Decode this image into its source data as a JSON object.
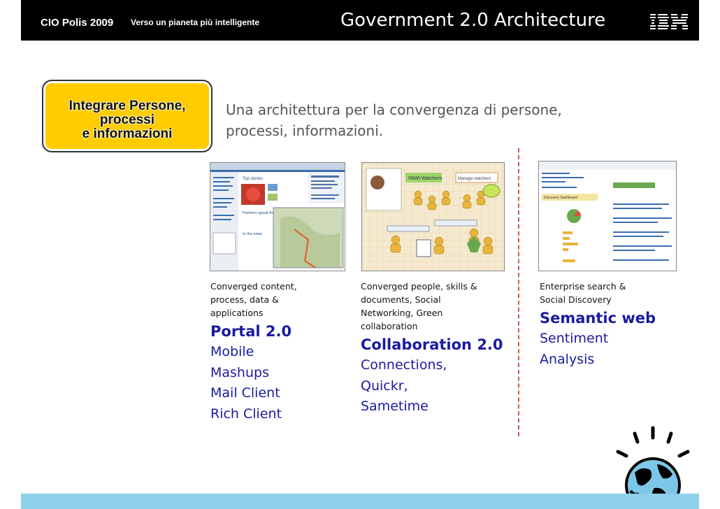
{
  "header": {
    "event": "CIO Polis 2009",
    "subtitle": "Verso un pianeta più intelligente",
    "title": "Government 2.0 Architecture",
    "logo": "IBM"
  },
  "callout": {
    "line1": "Integrare Persone,",
    "line2": "processi",
    "line3": "e informazioni"
  },
  "tagline": "Una architettura per la convergenza di persone, processi, informazioni.",
  "columns": [
    {
      "description": "Converged content,\nprocess, data &\napplications",
      "heading": "Portal 2.0",
      "items": [
        "Mobile",
        "Mashups",
        "Mail Client",
        "Rich Client"
      ]
    },
    {
      "description": "Converged people, skills &\ndocuments, Social\nNetworking, Green\ncollaboration",
      "heading": "Collaboration 2.0",
      "items": [
        "Connections,",
        "Quickr,",
        "Sametime"
      ]
    },
    {
      "description": "Enterprise search &\nSocial Discovery",
      "heading": "Semantic web",
      "items": [
        "Sentiment",
        "Analysis"
      ]
    }
  ],
  "screenshots": {
    "portal": {
      "top_stories": "Top stories",
      "partners_text": "Partners speak their minds",
      "in_the_news": "In the news"
    },
    "collaboration": {
      "watchers": "IWWI Watchers",
      "manage_watchers": "Manage watchers"
    },
    "semantic": {
      "discovery_dashboard": "Discovery Dashboard"
    }
  },
  "colors": {
    "header_bg": "#000000",
    "callout_bg": "#ffcc00",
    "accent_text": "#1a1aa0",
    "divider": "#e05050",
    "bottom_bar": "#8fd0ea"
  }
}
